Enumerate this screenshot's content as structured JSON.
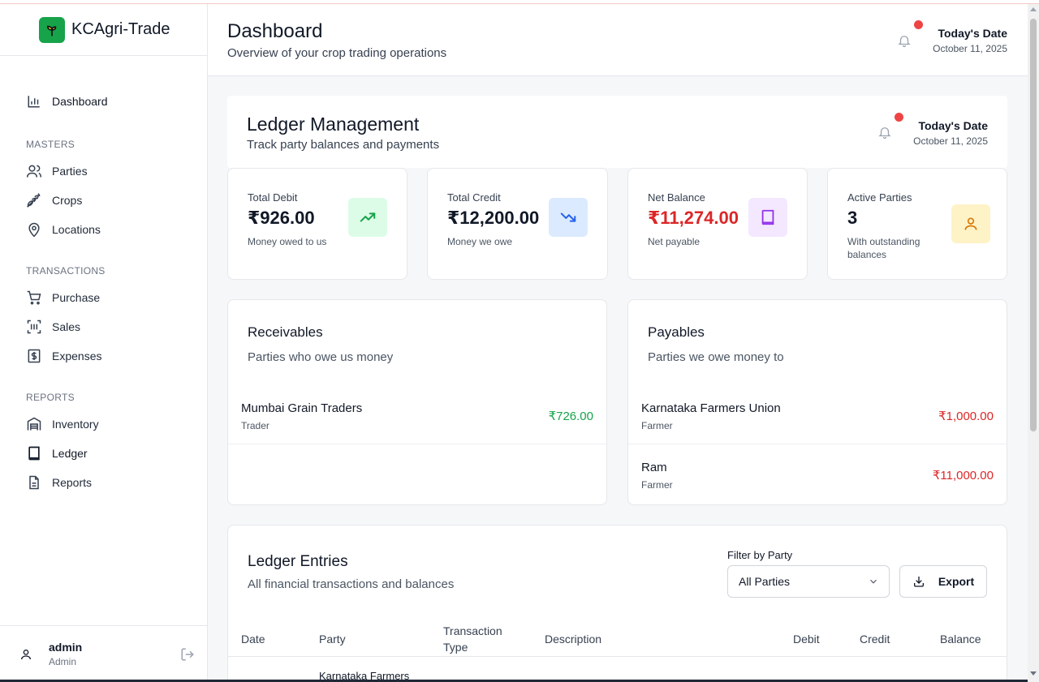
{
  "app": {
    "name": "KCAgri-Trade"
  },
  "sidebar": {
    "dashboard": "Dashboard",
    "sections": {
      "masters": "MASTERS",
      "transactions": "TRANSACTIONS",
      "reports": "REPORTS"
    },
    "items": {
      "parties": "Parties",
      "crops": "Crops",
      "locations": "Locations",
      "purchase": "Purchase",
      "sales": "Sales",
      "expenses": "Expenses",
      "inventory": "Inventory",
      "ledger": "Ledger",
      "reports": "Reports"
    },
    "user": {
      "name": "admin",
      "role": "Admin"
    }
  },
  "header": {
    "title": "Dashboard",
    "subtitle": "Overview of your crop trading operations",
    "date_label": "Today's Date",
    "date_value": "October 11, 2025"
  },
  "ledger": {
    "title": "Ledger Management",
    "subtitle": "Track party balances and payments",
    "date_label": "Today's Date",
    "date_value": "October 11, 2025"
  },
  "stats": [
    {
      "label": "Total Debit",
      "value": "₹926.00",
      "note": "Money owed to us",
      "icon": "trending-up-icon",
      "color": "#111827"
    },
    {
      "label": "Total Credit",
      "value": "₹12,200.00",
      "note": "Money we owe",
      "icon": "trending-down-icon",
      "color": "#111827"
    },
    {
      "label": "Net Balance",
      "value": "₹11,274.00",
      "note": "Net payable",
      "icon": "book-icon",
      "color": "#dc2626"
    },
    {
      "label": "Active Parties",
      "value": "3",
      "note": "With outstanding balances",
      "icon": "user-icon",
      "color": "#111827"
    }
  ],
  "receivables": {
    "title": "Receivables",
    "subtitle": "Parties who owe us money",
    "rows": [
      {
        "name": "Mumbai Grain Traders",
        "type": "Trader",
        "amount": "₹726.00"
      }
    ]
  },
  "payables": {
    "title": "Payables",
    "subtitle": "Parties we owe money to",
    "rows": [
      {
        "name": "Karnataka Farmers Union",
        "type": "Farmer",
        "amount": "₹1,000.00"
      },
      {
        "name": "Ram",
        "type": "Farmer",
        "amount": "₹11,000.00"
      }
    ]
  },
  "entries": {
    "title": "Ledger Entries",
    "subtitle": "All financial transactions and balances",
    "filter_label": "Filter by Party",
    "filter_value": "All Parties",
    "export_label": "Export",
    "columns": [
      "Date",
      "Party",
      "Transaction Type",
      "Description",
      "Debit",
      "Credit",
      "Balance"
    ],
    "first_row_party": "Karnataka Farmers"
  },
  "colors": {
    "accent": "#16a34a",
    "debit": "#16a34a",
    "credit": "#dc2626"
  }
}
